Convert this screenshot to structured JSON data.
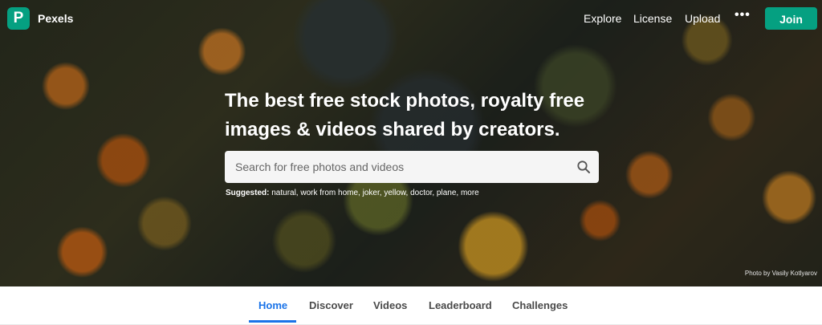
{
  "navbar": {
    "logo_letter": "P",
    "brand": "Pexels",
    "links": [
      "Explore",
      "License",
      "Upload"
    ],
    "more": "•••",
    "join_label": "Join"
  },
  "hero": {
    "headline_line1": "The best free stock photos, royalty free",
    "headline_line2": "images & videos shared by creators.",
    "search": {
      "placeholder": "Search for free photos and videos",
      "icon": "search-icon"
    },
    "suggested": {
      "label": "Suggested:",
      "terms": [
        "natural,",
        "work from home,",
        "joker,",
        "yellow,",
        "doctor,",
        "plane,",
        "more"
      ]
    },
    "photo_credit": "Photo by Vasily Kotlyarov"
  },
  "tabs": {
    "items": [
      "Home",
      "Discover",
      "Videos",
      "Leaderboard",
      "Challenges"
    ],
    "active": "Home"
  },
  "colors": {
    "brand_green": "#05a081",
    "active_tab_blue": "#1a73e8"
  }
}
